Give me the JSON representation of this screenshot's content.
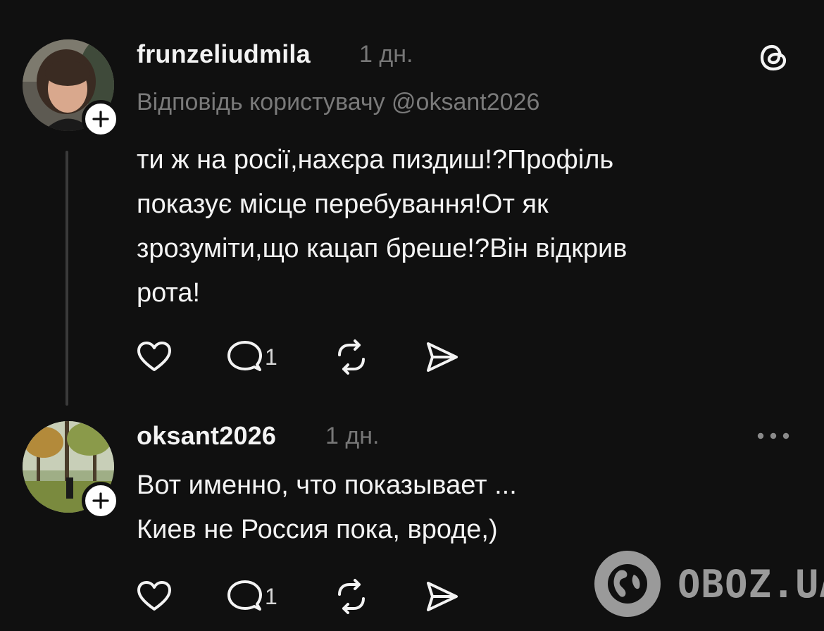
{
  "posts": [
    {
      "username": "frunzeliudmila",
      "time": "1 дн.",
      "reply_to": "Відповідь користувачу @oksant2026",
      "text": "ти ж на росії,нахєра пиздиш!?Профіль\nпоказує місце перебування!От як\nзрозуміти,що кацап бреше!?Він відкрив\nрота!",
      "reply_count": "1",
      "avatar_icon": "profile-photo-woman",
      "corner_icon": "threads-logo-icon"
    },
    {
      "username": "oksant2026",
      "time": "1 дн.",
      "text": "Вот именно, что показывает ...\nКиев не Россия пока, вроде,)",
      "reply_count": "1",
      "avatar_icon": "profile-photo-park",
      "corner_icon": "more-options-icon"
    }
  ],
  "watermark": {
    "text": "OBOZ.UA",
    "icon": "globe-logo-icon"
  },
  "colors": {
    "background": "#101010",
    "text": "#f3f3f3",
    "muted": "#777777",
    "thread_line": "#3a3a3a"
  }
}
